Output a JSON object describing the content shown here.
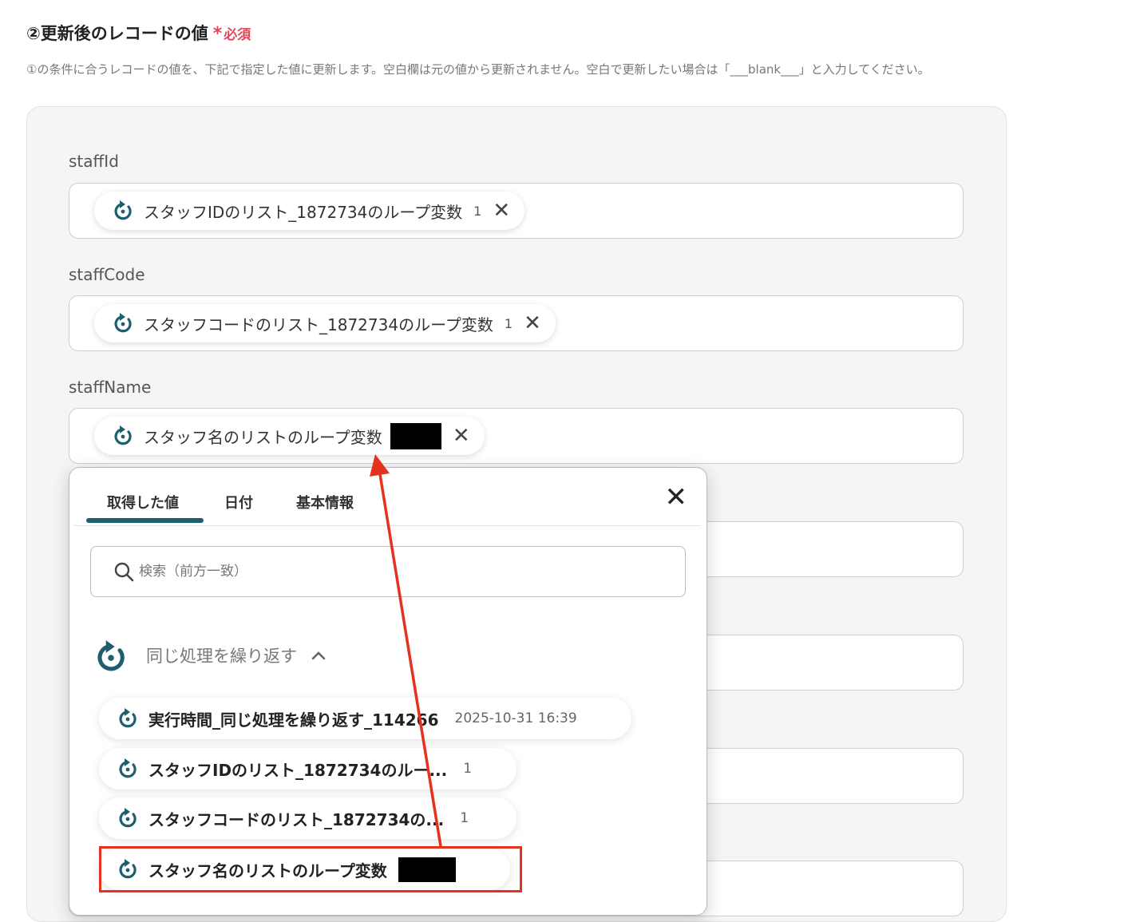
{
  "section": {
    "title": "②更新後のレコードの値",
    "required": "必須",
    "description": "①の条件に合うレコードの値を、下記で指定した値に更新します。空白欄は元の値から更新されません。空白で更新したい場合は「___blank___」と入力してください。"
  },
  "fields": [
    {
      "label": "staffId",
      "chip": {
        "icon": "loop-icon",
        "text": "スタッフIDのリスト_1872734のループ変数",
        "value": "1"
      }
    },
    {
      "label": "staffCode",
      "chip": {
        "icon": "loop-icon",
        "text": "スタッフコードのリスト_1872734のループ変数",
        "value": "1"
      }
    },
    {
      "label": "staffName",
      "chip": {
        "icon": "loop-icon",
        "text": "スタッフ名のリストのループ変数",
        "value_redacted": true
      }
    }
  ],
  "popup": {
    "tabs": [
      "取得した値",
      "日付",
      "基本情報"
    ],
    "active_tab": "取得した値",
    "search_placeholder": "検索（前方一致）",
    "group": {
      "title": "同じ処理を繰り返す",
      "icon": "loop-icon",
      "expanded": true
    },
    "items": [
      {
        "text": "実行時間_同じ処理を繰り返す_114266",
        "value": "2025-10-31 16:39"
      },
      {
        "text": "スタッフIDのリスト_1872734のルー...",
        "value": "1"
      },
      {
        "text": "スタッフコードのリスト_1872734の...",
        "value": "1"
      },
      {
        "text": "スタッフ名のリストのループ変数",
        "value_redacted": true,
        "highlighted": true
      }
    ]
  },
  "colors": {
    "accent": "#1d5f6e",
    "required": "#e2465a",
    "annotation": "#e4321e"
  }
}
